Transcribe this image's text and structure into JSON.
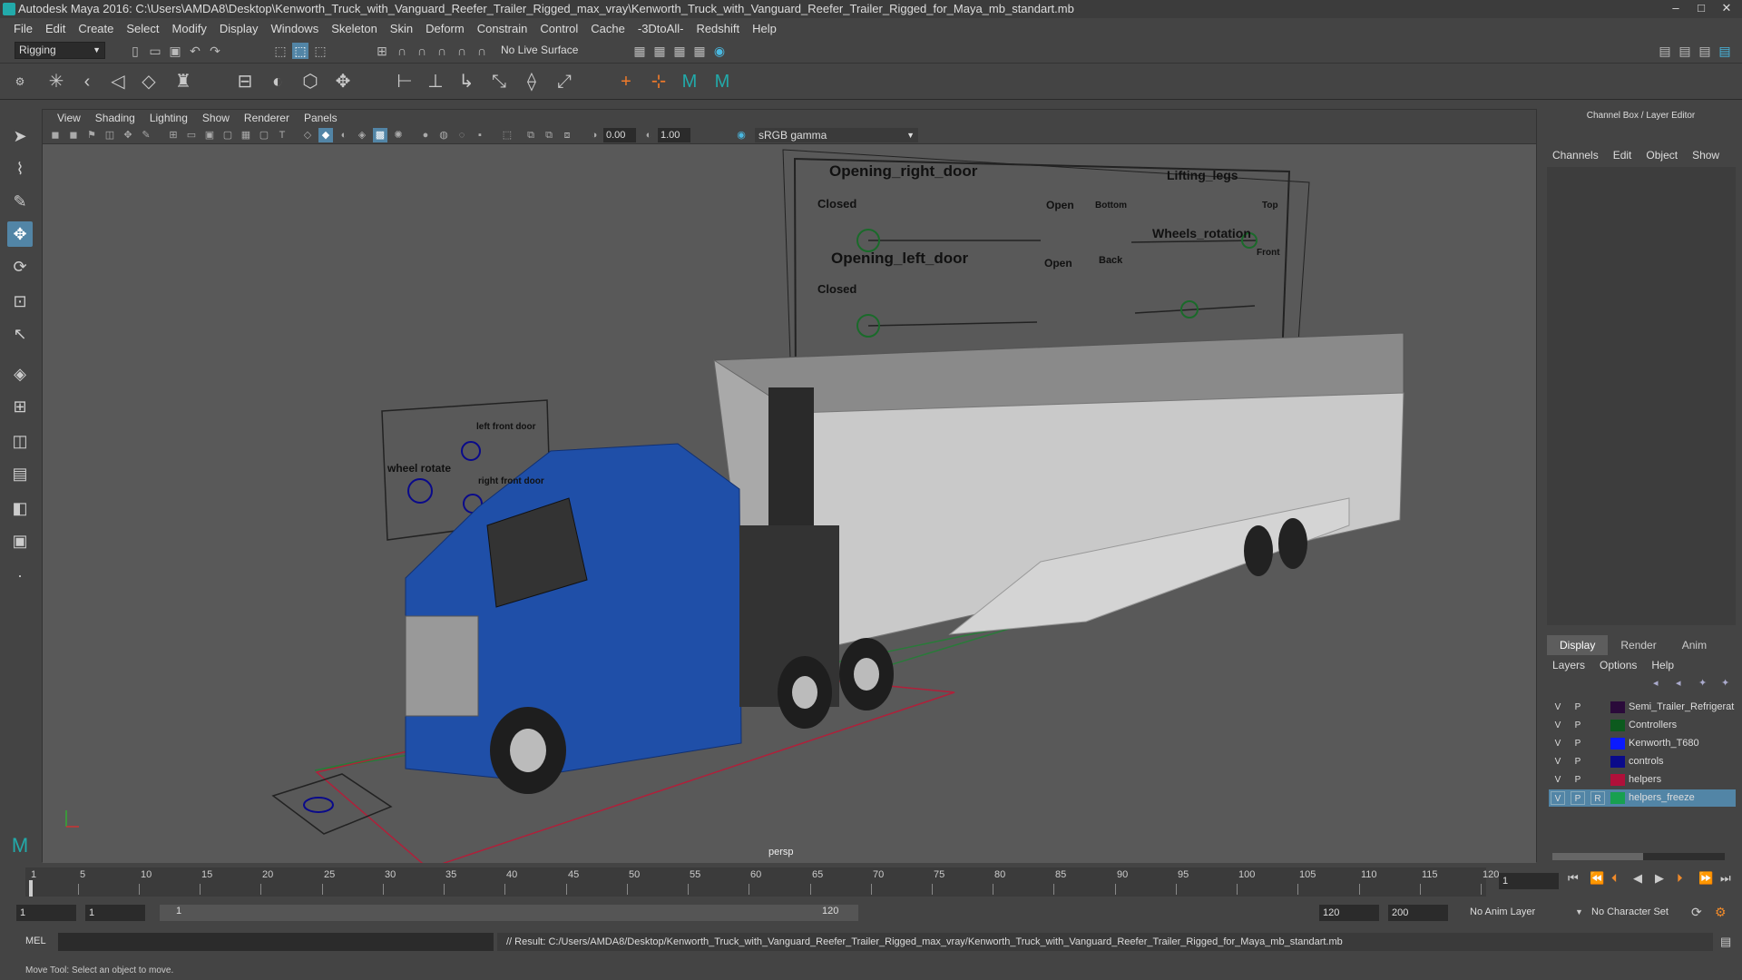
{
  "app": {
    "title": "Autodesk Maya 2016: C:\\Users\\AMDA8\\Desktop\\Kenworth_Truck_with_Vanguard_Reefer_Trailer_Rigged_max_vray\\Kenworth_Truck_with_Vanguard_Reefer_Trailer_Rigged_for_Maya_mb_standart.mb",
    "window_buttons": [
      "–",
      "□",
      "✕"
    ]
  },
  "menubar": [
    "File",
    "Edit",
    "Create",
    "Select",
    "Modify",
    "Display",
    "Windows",
    "Skeleton",
    "Skin",
    "Deform",
    "Constrain",
    "Control",
    "Cache",
    "-3DtoAll-",
    "Redshift",
    "Help"
  ],
  "statusline": {
    "mode": "Rigging",
    "live_surface": "No Live Surface"
  },
  "panel": {
    "menu": [
      "View",
      "Shading",
      "Lighting",
      "Show",
      "Renderer",
      "Panels"
    ],
    "near_value": "0.00",
    "far_value": "1.00",
    "color_space": "sRGB gamma",
    "camera_label": "persp"
  },
  "controls_board": {
    "opening_right_door": "Opening_right_door",
    "opening_left_door": "Opening_left_door",
    "lifting_legs": "Lifting_legs",
    "wheels_rotation": "Wheels_rotation",
    "closed": "Closed",
    "open": "Open",
    "bottom": "Bottom",
    "top": "Top",
    "back": "Back",
    "front": "Front"
  },
  "small_board": {
    "wheel_rotate": "wheel rotate",
    "left_front_door": "left front door",
    "right_front_door": "right front door"
  },
  "channel_box": {
    "title": "Channel Box / Layer Editor",
    "menu": [
      "Channels",
      "Edit",
      "Object",
      "Show"
    ]
  },
  "layer_editor": {
    "tabs": [
      "Display",
      "Render",
      "Anim"
    ],
    "menu": [
      "Layers",
      "Options",
      "Help"
    ],
    "layers": [
      {
        "v": "V",
        "p": "P",
        "r": "",
        "name": "Semi_Trailer_Refrigerat",
        "color": "#2a0a3a",
        "selected": false
      },
      {
        "v": "V",
        "p": "P",
        "r": "",
        "name": "Controllers",
        "color": "#0c5a1e",
        "selected": false
      },
      {
        "v": "V",
        "p": "P",
        "r": "",
        "name": "Kenworth_T680",
        "color": "#0a1aff",
        "selected": false
      },
      {
        "v": "V",
        "p": "P",
        "r": "",
        "name": "controls",
        "color": "#0a0a8a",
        "selected": false
      },
      {
        "v": "V",
        "p": "P",
        "r": "",
        "name": "helpers",
        "color": "#b0103a",
        "selected": false
      },
      {
        "v": "V",
        "p": "P",
        "r": "R",
        "name": "helpers_freeze",
        "color": "#18a050",
        "selected": true
      }
    ]
  },
  "timeline": {
    "ticks": [
      "1",
      "5",
      "10",
      "15",
      "20",
      "25",
      "30",
      "35",
      "40",
      "45",
      "50",
      "55",
      "60",
      "65",
      "70",
      "75",
      "80",
      "85",
      "90",
      "95",
      "100",
      "105",
      "110",
      "115",
      "120"
    ],
    "current_frame": "1"
  },
  "range": {
    "start": "1",
    "start2": "1",
    "slider_start": "1",
    "slider_end": "120",
    "end": "120",
    "end2": "200",
    "anim_layer": "No Anim Layer",
    "char_set": "No Character Set"
  },
  "command": {
    "lang": "MEL",
    "result": "// Result: C:/Users/AMDA8/Desktop/Kenworth_Truck_with_Vanguard_Reefer_Trailer_Rigged_max_vray/Kenworth_Truck_with_Vanguard_Reefer_Trailer_Rigged_for_Maya_mb_standart.mb"
  },
  "helpline": "Move Tool: Select an object to move.",
  "colors": {
    "accent": "#5285a6",
    "bg": "#444444",
    "viewport": "#595959"
  }
}
